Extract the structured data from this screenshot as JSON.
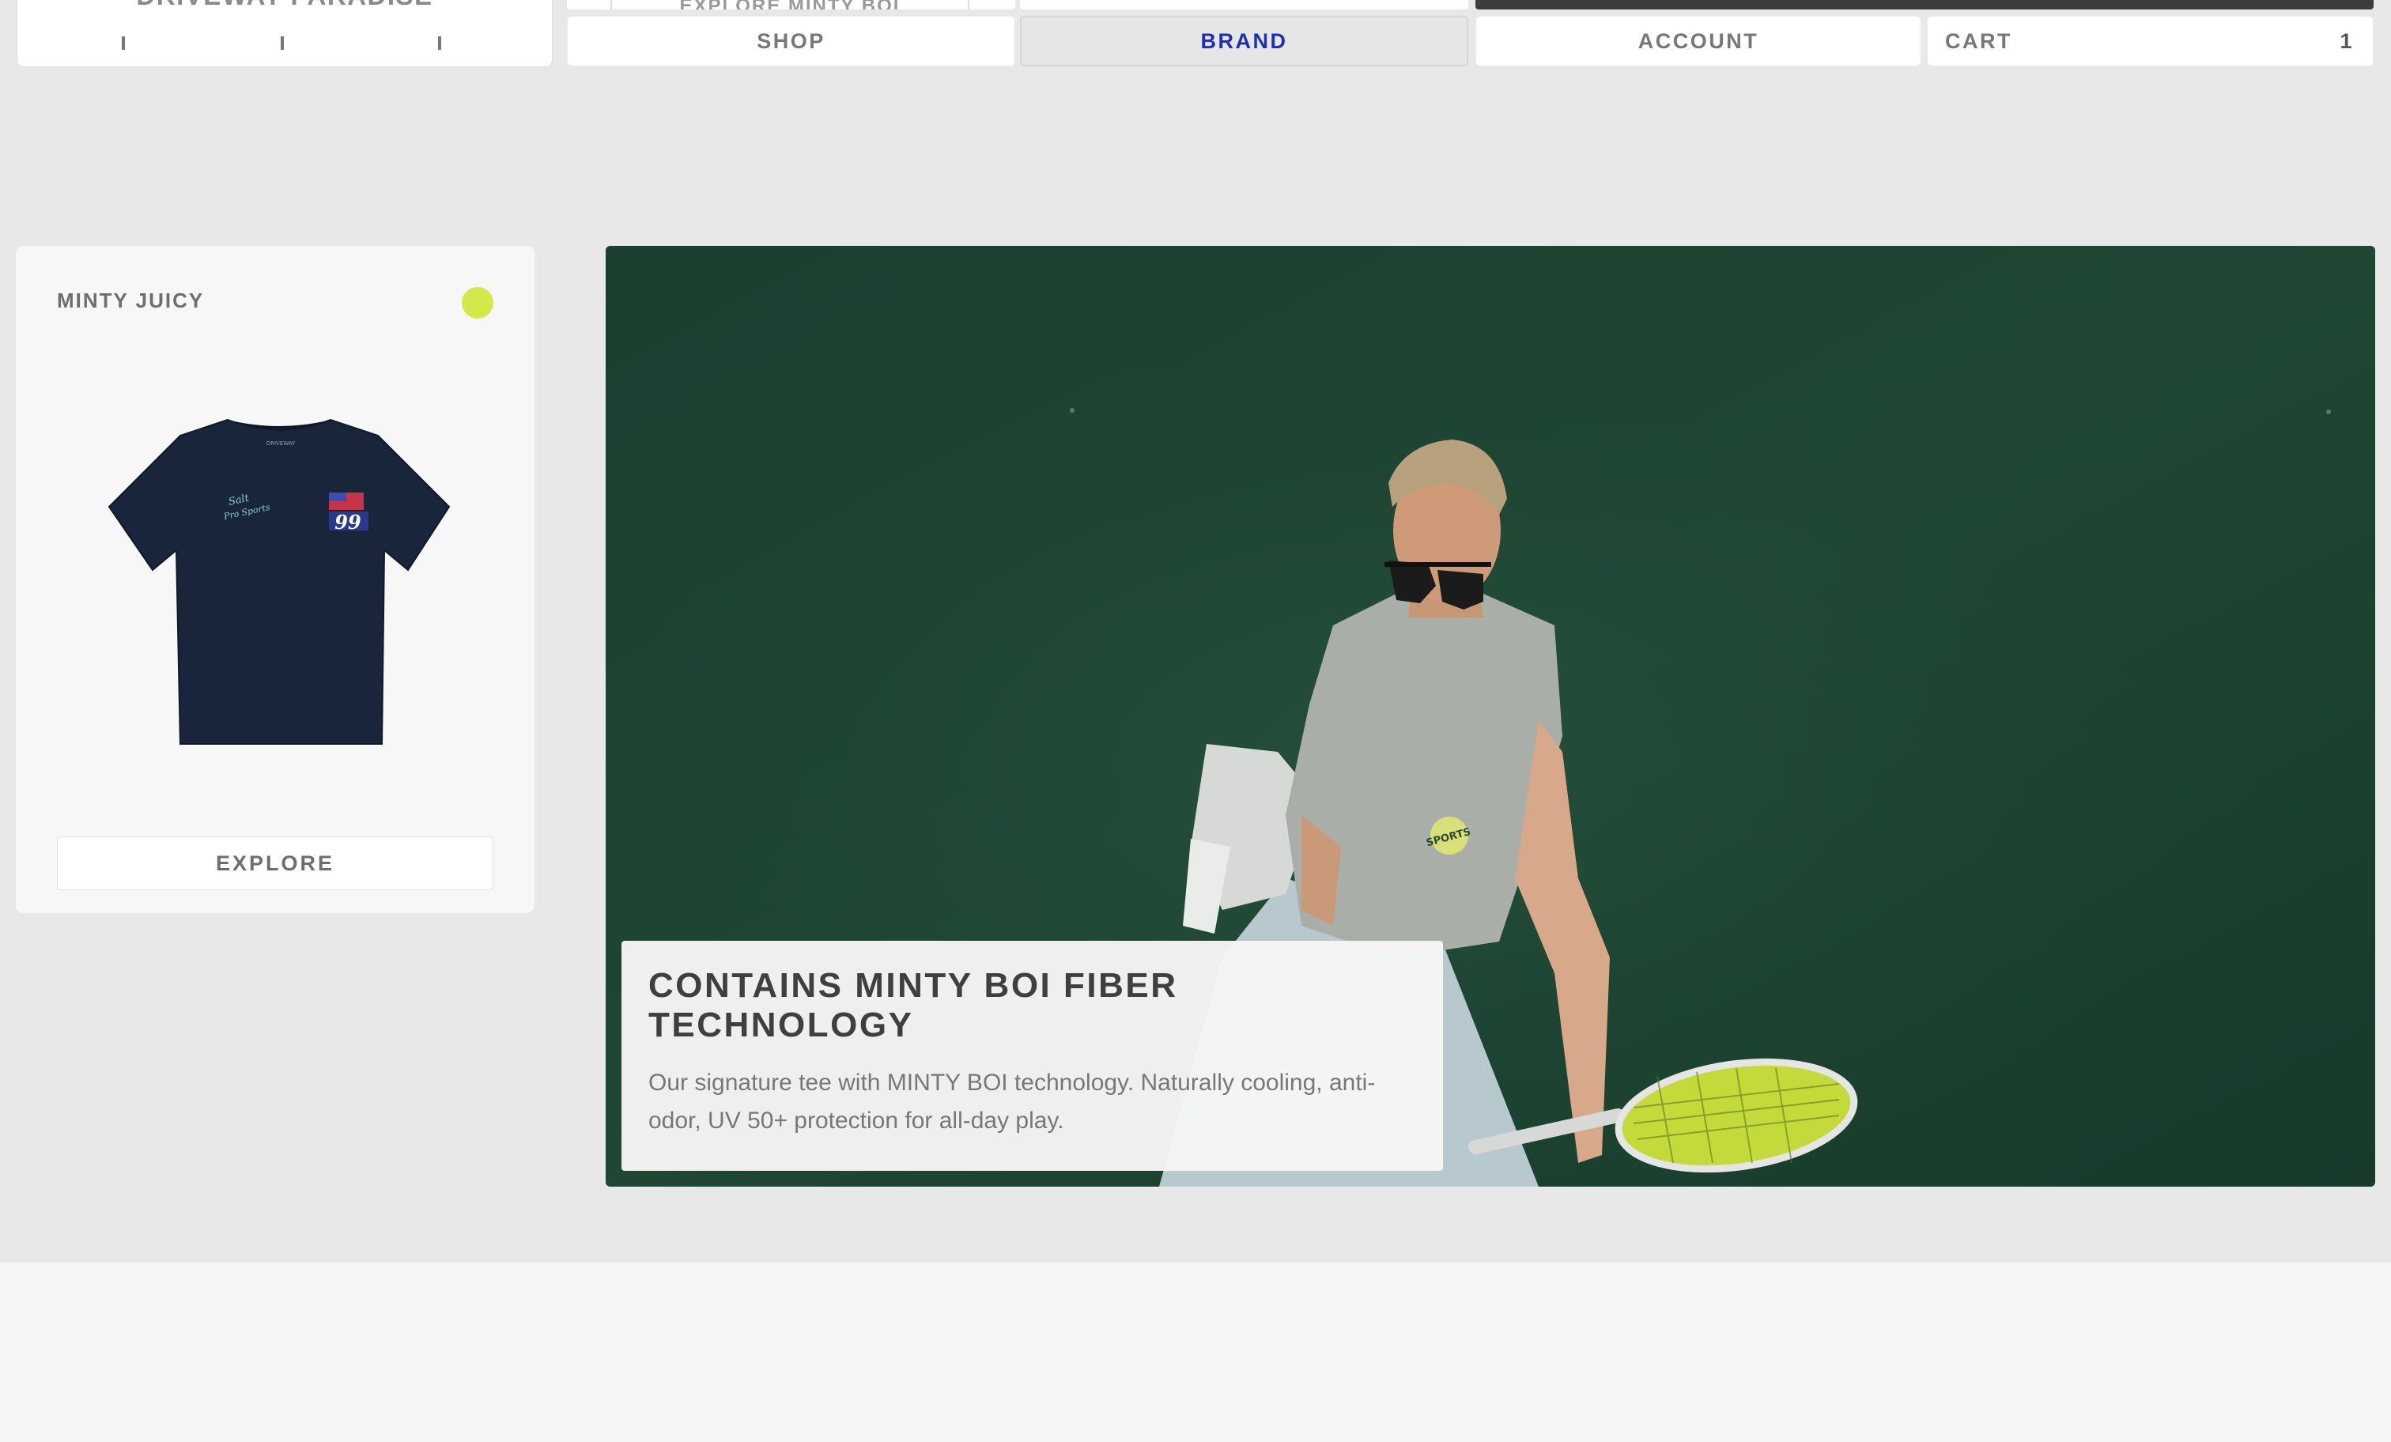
{
  "header": {
    "brand": "DRIVEWAY PARADISE",
    "ghost_link": "EXPLORE MINTY BOI",
    "nav": {
      "shop": "SHOP",
      "brand": "BRAND",
      "account": "ACCOUNT",
      "cart": "CART",
      "cart_count": "1"
    }
  },
  "product_card": {
    "name": "MINTY JUICY",
    "status_color": "#d3e84a",
    "tee_color": "#18253a",
    "explore_label": "EXPLORE"
  },
  "hero": {
    "title": "CONTAINS MINTY BOI FIBER TECHNOLOGY",
    "description": "Our signature tee with MINTY BOI technology. Naturally cooling, anti-odor, UV 50+ protection for all-day play.",
    "background_color": "#1d4432"
  },
  "colors": {
    "active_nav": "#1d2fb7",
    "nav_text": "#777777",
    "page_bg": "#e8e8e8"
  }
}
